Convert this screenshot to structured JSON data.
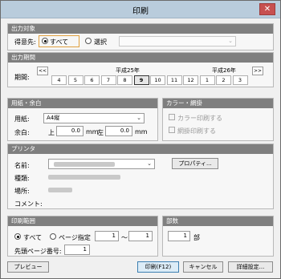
{
  "window": {
    "title": "印刷",
    "close": "✕"
  },
  "target": {
    "header": "出力対象",
    "customer_label": "得意先:",
    "all_label": "すべて",
    "select_label": "選択"
  },
  "period": {
    "header": "出力期間",
    "label": "期間:",
    "year1": "平成25年",
    "year2": "平成26年",
    "prev": "<<",
    "next": ">>",
    "months": [
      "4",
      "5",
      "6",
      "7",
      "8",
      "9",
      "10",
      "11",
      "12",
      "1",
      "2",
      "3"
    ],
    "selected_month": "9"
  },
  "paper": {
    "header": "用紙・余白",
    "paper_label": "用紙:",
    "paper_value": "A4縦",
    "margin_label": "余白:",
    "top_label": "上",
    "top_value": "0.0",
    "left_label": "左",
    "left_value": "0.0",
    "unit": "mm"
  },
  "color": {
    "header": "カラー・網掛",
    "color_print": "カラー印刷する",
    "shade_print": "網掛印刷する"
  },
  "printer": {
    "header": "プリンタ",
    "name_label": "名前:",
    "properties_button": "プロパティ...",
    "type_label": "種類:",
    "location_label": "場所:",
    "comment_label": "コメント:"
  },
  "range": {
    "header": "印刷範囲",
    "all_label": "すべて",
    "page_label": "ページ指定",
    "from": "1",
    "tilde": "～",
    "to": "1",
    "start_page_label": "先頭ページ番号:",
    "start_page_value": "1"
  },
  "copies": {
    "header": "部数",
    "value": "1",
    "unit": "部"
  },
  "footer": {
    "preview": "プレビュー",
    "print": "印刷(F12)",
    "cancel": "キャンセル",
    "detail": "詳細設定..."
  }
}
